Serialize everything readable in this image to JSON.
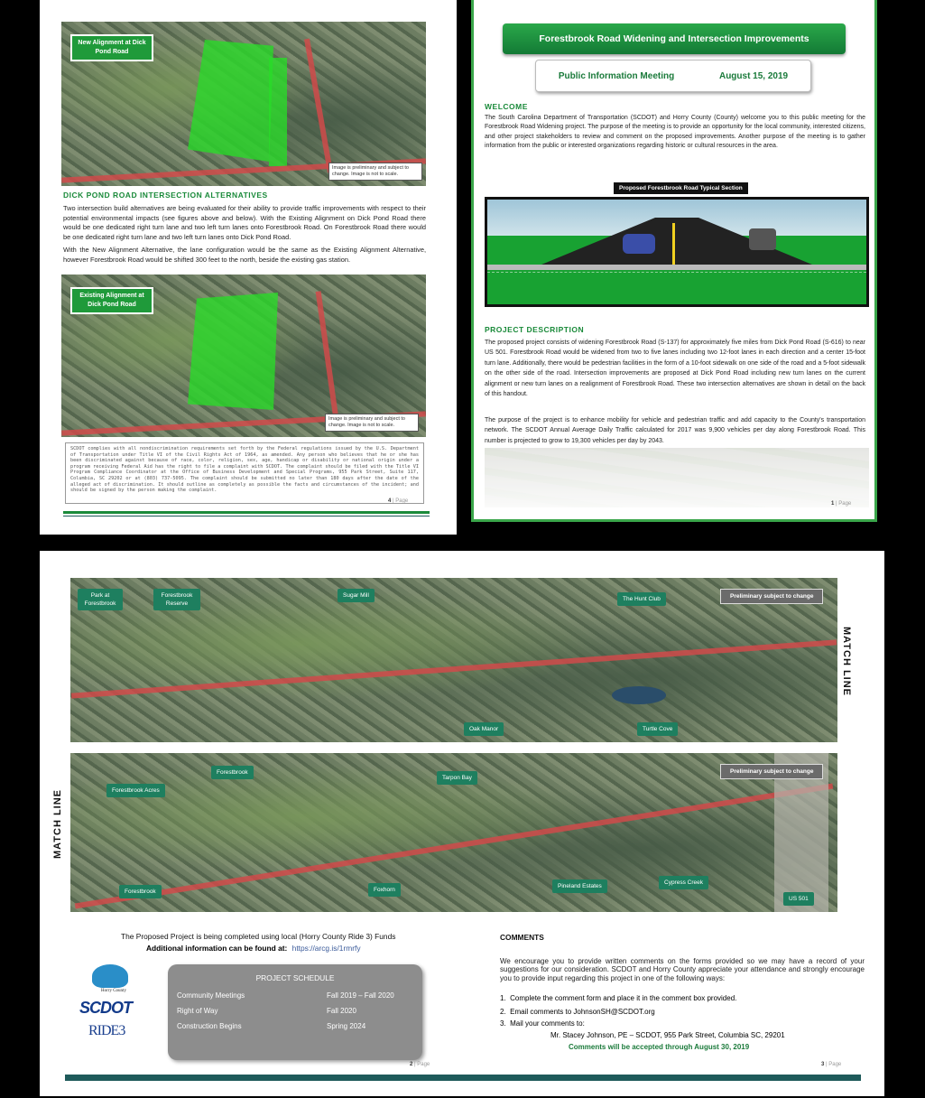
{
  "page4": {
    "map_top_label": "New Alignment at Dick Pond Road",
    "map_note": "Image is preliminary and subject to change. Image is not to scale.",
    "section_title": "DICK POND ROAD INTERSECTION ALTERNATIVES",
    "para1": "Two intersection build alternatives are being evaluated for their ability to provide traffic improvements with respect to their potential environmental impacts (see figures above and below). With the Existing Alignment on Dick Pond Road there would be one dedicated right turn lane and two left turn lanes onto Forestbrook Road. On Forestbrook Road there would be one dedicated right turn lane and two left turn lanes onto Dick Pond Road.",
    "para2": "With the New Alignment Alternative, the lane configuration would be the same as the Existing Alignment Alternative, however Forestbrook Road would be shifted 300 feet to the north, beside the existing gas station.",
    "map_bottom_label": "Existing Alignment at Dick Pond Road",
    "map_note2": "Image is preliminary and subject to change. Image is not to scale.",
    "title_vi": "SCDOT complies with all nondiscrimination requirements set forth by the Federal regulations issued by the U.S. Department of Transportation under Title VI of the Civil Rights Act of 1964, as amended. Any person who believes that he or she has been discriminated against because of race, color, religion, sex, age, handicap or disability or national origin under a program receiving Federal Aid has the right to file a complaint with SCDOT. The complaint should be filed with the Title VI Program Compliance Coordinator at the Office of Business Development and Special Programs, 955 Park Street, Suite 117, Columbia, SC 29202 or at (803) 737-5095. The complaint should be submitted no later than 180 days after the date of the alleged act of discrimination. It should outline as completely as possible the facts and circumstances of the incident; and should be signed by the person making the complaint.",
    "page_num": "4",
    "page_word": "Page"
  },
  "page1": {
    "title": "Forestbrook Road Widening and Intersection Improvements",
    "meeting_label": "Public Information Meeting",
    "meeting_date": "August 15, 2019",
    "welcome_title": "WELCOME",
    "welcome_text": "The South Carolina Department of Transportation (SCDOT) and Horry County (County) welcome you to this public meeting for the Forestbrook Road Widening project. The purpose of the meeting is to provide an opportunity for the local community, interested citizens, and other project stakeholders to review and comment on the proposed improvements. Another purpose of the meeting is to gather information from the public or interested organizations regarding historic or cultural resources in the area.",
    "typical_section_label": "Proposed Forestbrook Road Typical Section",
    "desc_title": "PROJECT DESCRIPTION",
    "desc_para1": "The proposed project consists of widening Forestbrook Road (S-137) for approximately five miles from Dick Pond Road (S-616) to near US 501. Forestbrook Road would be widened from two to five lanes including two 12-foot lanes in each direction and a center 15-foot turn lane. Additionally, there would be pedestrian facilities in the form of a 10-foot sidewalk on one side of the road and a 5-foot sidewalk on the other side of the road. Intersection improvements are proposed at Dick Pond Road including new turn lanes on the current alignment or new turn lanes on a realignment of Forestbrook Road. These two intersection alternatives are shown in detail on the back of this handout.",
    "desc_para2": "The purpose of the project is to enhance mobility for vehicle and pedestrian traffic and add capacity to the County's transportation network. The SCDOT Annual Average Daily Traffic calculated for 2017 was 9,900 vehicles per day along Forestbrook Road. This number is projected to grow to 19,300 vehicles per day by 2043.",
    "page_num": "1",
    "page_word": "Page"
  },
  "map_strip": {
    "top_labels": [
      "Park at Forestbrook",
      "Forestbrook Reserve",
      "Sugar Mill",
      "The Hunt Club",
      "Oak Manor",
      "Turtle Cove"
    ],
    "bottom_labels": [
      "Forestbrook",
      "Forestbrook Acres",
      "Tarpon Bay",
      "Forestbrook",
      "Foxhorn",
      "Pineland Estates",
      "Cypress Creek",
      "US 501"
    ],
    "prelim": "Preliminary subject to change",
    "match_line": "MATCH LINE"
  },
  "page2": {
    "funds_line": "The Proposed Project is being completed using local (Horry County Ride 3) Funds",
    "info_label": "Additional information can be found at:",
    "info_link": "https://arcg.is/1rmrfy",
    "schedule_title": "PROJECT SCHEDULE",
    "schedule": [
      {
        "item": "Community Meetings",
        "when": "Fall 2019 – Fall 2020"
      },
      {
        "item": "Right of Way",
        "when": "Fall 2020"
      },
      {
        "item": "Construction Begins",
        "when": "Spring 2024"
      }
    ],
    "logo_horry": "Horry County",
    "logo_scdot": "SCDOT",
    "logo_ride": "RIDE3",
    "page_num": "2",
    "page_word": "Page"
  },
  "page3": {
    "comments_title": "COMMENTS",
    "comments_text": "We encourage you to provide written comments on the forms provided so we may have a record of your suggestions for our consideration. SCDOT and Horry County appreciate your attendance and strongly encourage you to provide input regarding this project in one of the following ways:",
    "items": [
      "Complete the comment form and place it in the comment box provided.",
      "Email comments to JohnsonSH@SCDOT.org",
      "Mail your comments to:"
    ],
    "mail_address": "Mr. Stacey Johnson, PE – SCDOT, 955 Park Street, Columbia SC, 29201",
    "deadline": "Comments will be accepted through August 30, 2019",
    "page_num": "3",
    "page_word": "Page"
  },
  "colors": {
    "accent_green": "#1a8a3a",
    "road_red": "#d04a4a",
    "divider_teal": "#1e5a5a"
  }
}
